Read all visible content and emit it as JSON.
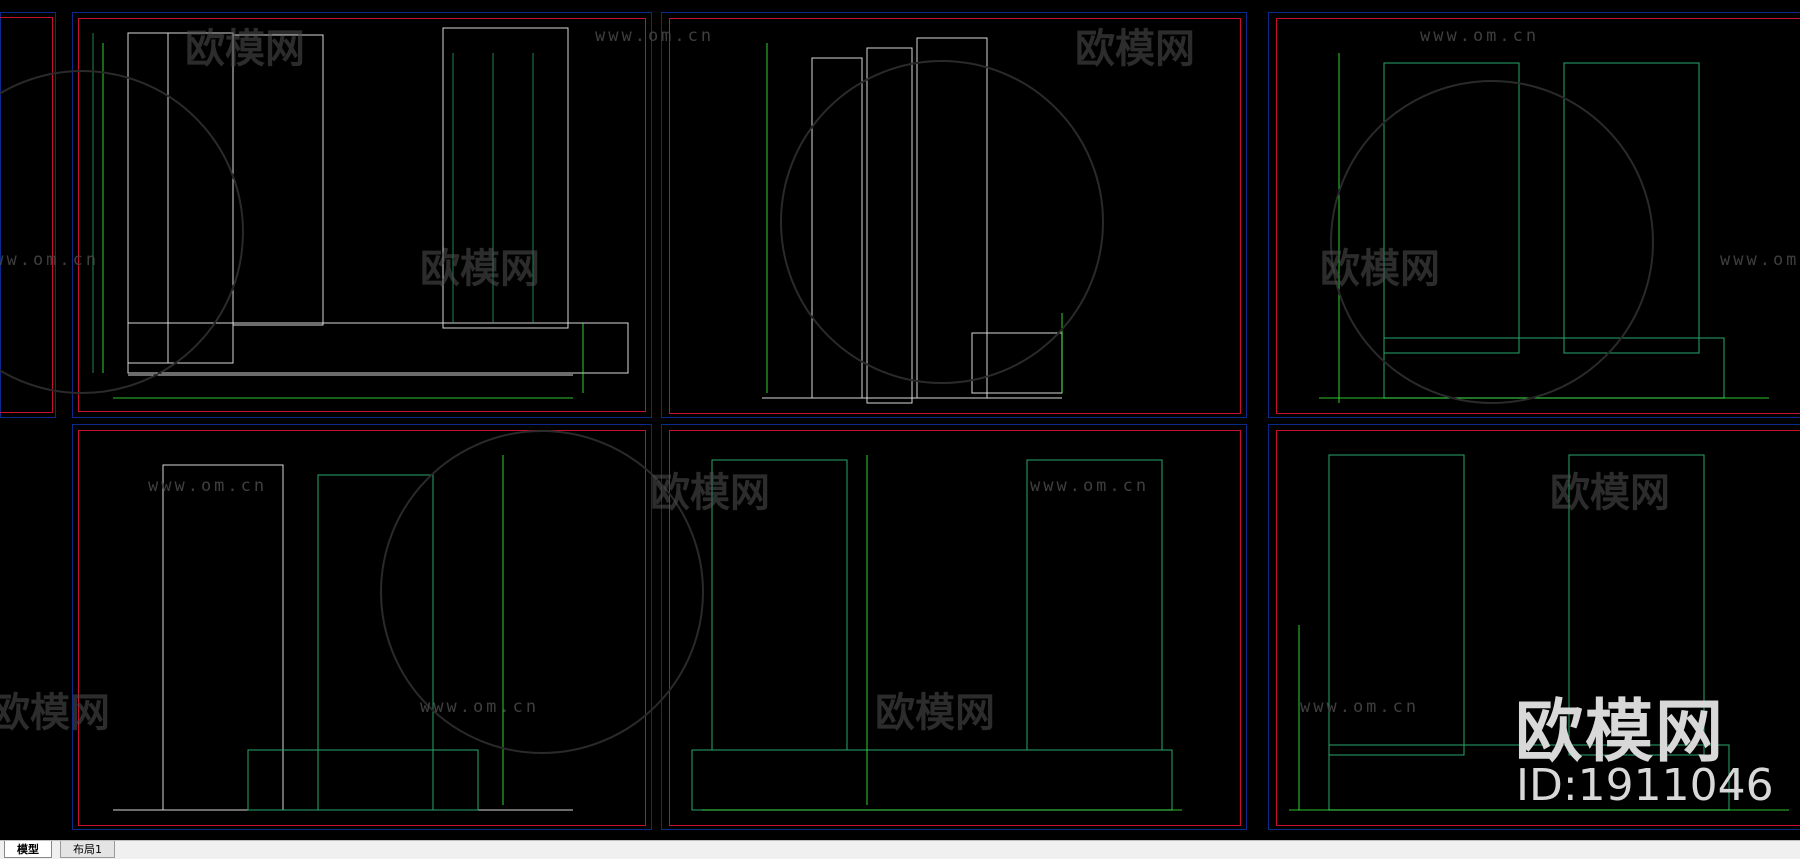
{
  "watermark": {
    "url": "www.om.cn",
    "logo_text": "欧模网"
  },
  "brand": {
    "name": "欧模网",
    "id": "ID:1911046"
  },
  "tabs": [
    {
      "label": "模型"
    },
    {
      "label": "布局1"
    }
  ],
  "colors": {
    "background": "#000000",
    "sheet_border": "#0a2a8c",
    "sheet_inner_border": "#c8102e",
    "line_white": "#d8d8d8",
    "line_green": "#2aa66b",
    "dimension_green": "#3cff3c"
  }
}
